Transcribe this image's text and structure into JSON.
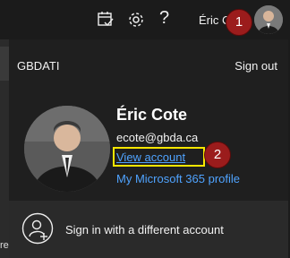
{
  "topbar": {
    "calendar_icon": "calendar-check-icon",
    "settings_icon": "gear-icon",
    "help_label": "?",
    "user_name": "Éric C"
  },
  "panel": {
    "org_name": "GBDATI",
    "sign_out_label": "Sign out",
    "full_name": "Éric Cote",
    "email": "ecote@gbda.ca",
    "view_account_label": "View account",
    "profile_label": "My Microsoft 365 profile",
    "switch_label": "Sign in with a different account"
  },
  "badges": {
    "badge1": "1",
    "badge2": "2"
  },
  "left_strip": {
    "letter": "re"
  },
  "colors": {
    "accent_link": "#4fa3ff",
    "badge": "#9b1c1c",
    "highlight": "#f7e600"
  }
}
